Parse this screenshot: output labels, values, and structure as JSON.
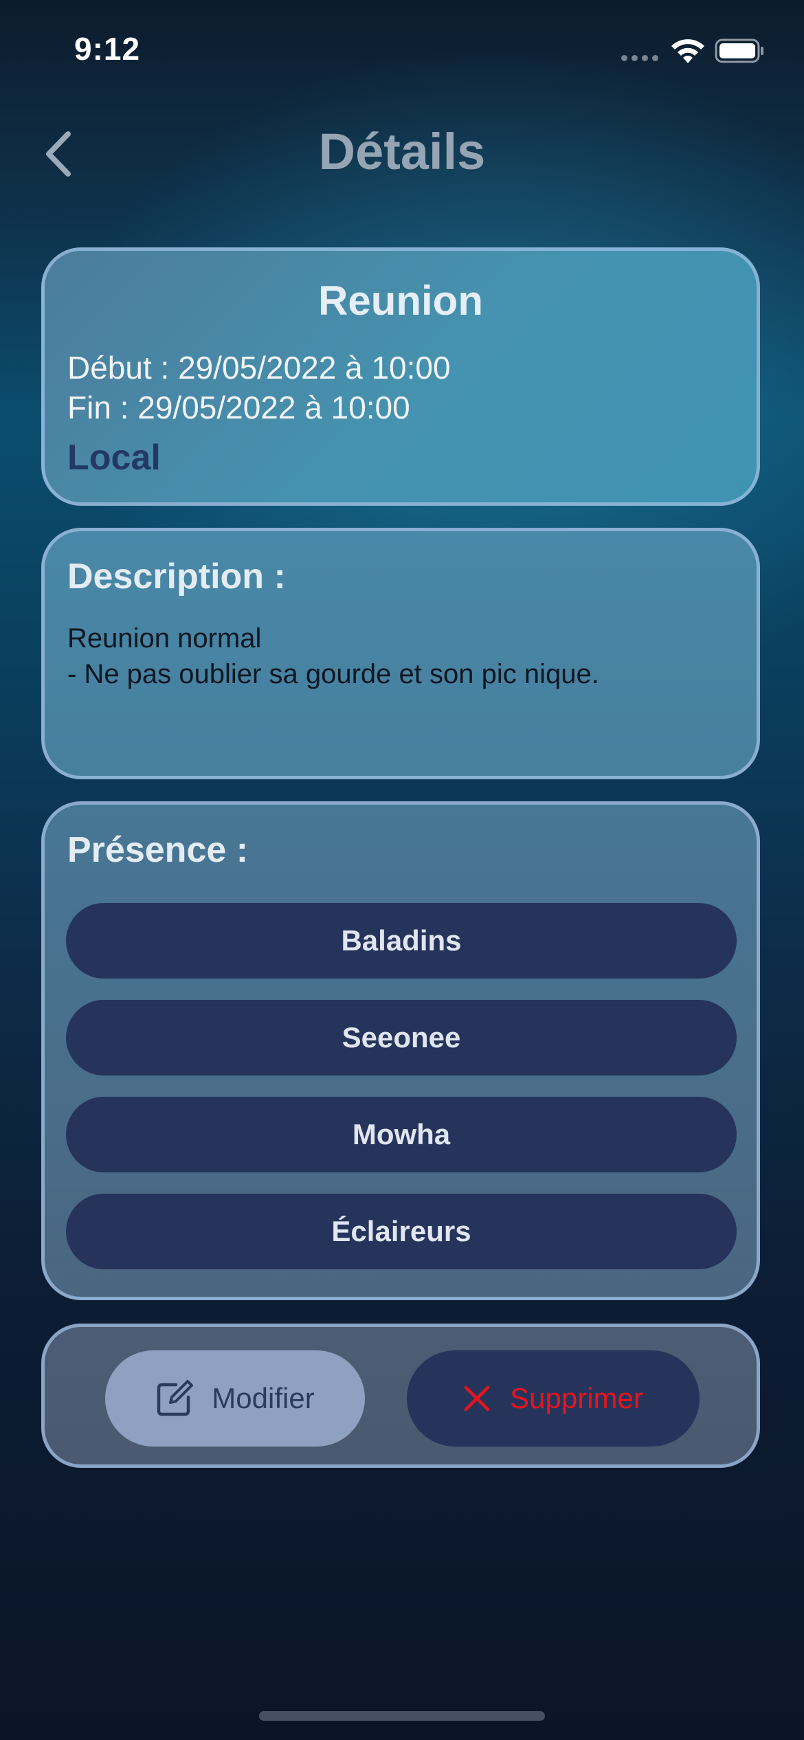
{
  "status_bar": {
    "time": "9:12",
    "icons": [
      "cellular-signal-icon",
      "wifi-icon",
      "battery-icon"
    ]
  },
  "header": {
    "title": "Détails",
    "back_icon": "chevron-left-icon"
  },
  "event": {
    "title": "Reunion",
    "start": "Début : 29/05/2022 à 10:00",
    "end": "Fin : 29/05/2022 à 10:00",
    "location": "Local"
  },
  "description": {
    "label": "Description :",
    "text": "Reunion normal\n- Ne pas oublier sa gourde et son pic nique."
  },
  "presence": {
    "label": "Présence :",
    "groups": [
      {
        "label": "Baladins"
      },
      {
        "label": "Seeonee"
      },
      {
        "label": "Mowha"
      },
      {
        "label": "Éclaireurs"
      }
    ]
  },
  "actions": {
    "edit_label": "Modifier",
    "edit_icon": "edit-square-pencil-icon",
    "delete_label": "Supprimer",
    "delete_icon": "x-mark-icon"
  },
  "colors": {
    "accent_dark": "#26345c",
    "accent_light": "#8fa1c0",
    "delete_red": "#e8141c",
    "location_text": "#243866"
  }
}
